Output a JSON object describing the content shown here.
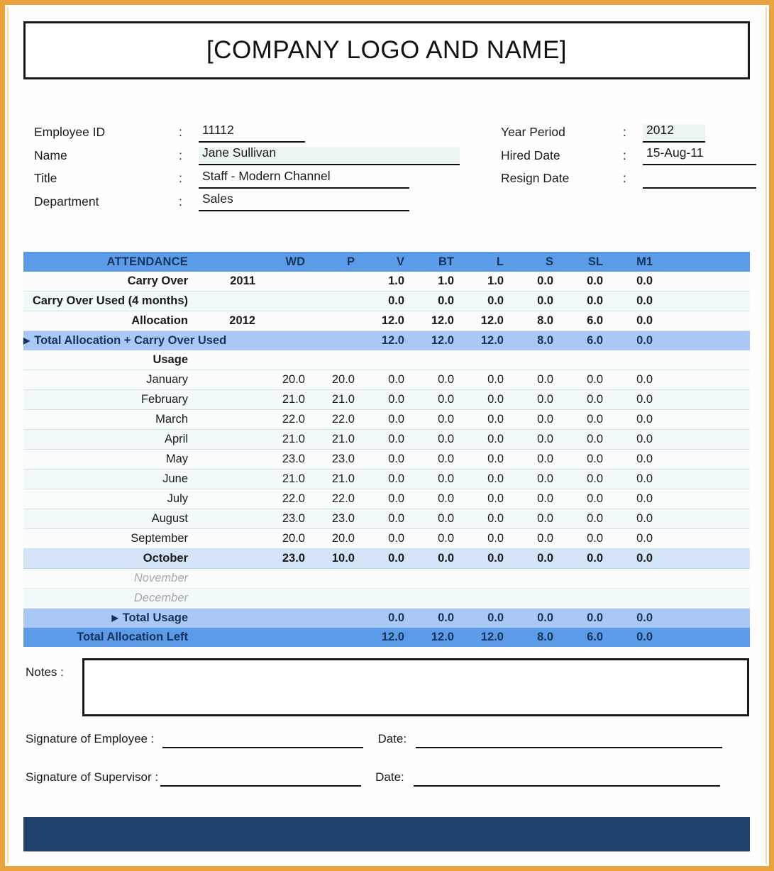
{
  "header": {
    "title": "[COMPANY LOGO AND NAME]"
  },
  "employee_info": {
    "left": [
      {
        "label": "Employee ID",
        "colon": ":",
        "value": "11112"
      },
      {
        "label": "Name",
        "colon": ":",
        "value": "Jane Sullivan"
      },
      {
        "label": "Title",
        "colon": ":",
        "value": "Staff - Modern Channel"
      },
      {
        "label": "Department",
        "colon": ":",
        "value": "Sales"
      }
    ],
    "right": [
      {
        "label": "Year Period",
        "colon": ":",
        "value": "2012"
      },
      {
        "label": "Hired Date",
        "colon": ":",
        "value": "15-Aug-11"
      },
      {
        "label": "Resign Date",
        "colon": ":",
        "value": ""
      }
    ]
  },
  "attendance": {
    "title": "ATTENDANCE",
    "columns": [
      "WD",
      "P",
      "V",
      "BT",
      "L",
      "S",
      "SL",
      "M1"
    ],
    "summary_top": [
      {
        "label": "Carry Over",
        "year": "2011",
        "wd": "",
        "p": "",
        "values": [
          "1.0",
          "1.0",
          "1.0",
          "0.0",
          "0.0",
          "0.0"
        ]
      },
      {
        "label": "Carry Over Used (4 months)",
        "year": "",
        "wd": "",
        "p": "",
        "values": [
          "0.0",
          "0.0",
          "0.0",
          "0.0",
          "0.0",
          "0.0"
        ]
      },
      {
        "label": "Allocation",
        "year": "2012",
        "wd": "",
        "p": "",
        "values": [
          "12.0",
          "12.0",
          "12.0",
          "8.0",
          "6.0",
          "0.0"
        ]
      }
    ],
    "total_allocation_row": {
      "marker": "▶",
      "label": "Total Allocation + Carry Over Used",
      "values": [
        "12.0",
        "12.0",
        "12.0",
        "8.0",
        "6.0",
        "0.0"
      ]
    },
    "usage_label": "Usage",
    "months": [
      {
        "name": "January",
        "values": [
          "20.0",
          "20.0",
          "0.0",
          "0.0",
          "0.0",
          "0.0",
          "0.0",
          "0.0"
        ],
        "state": "normal"
      },
      {
        "name": "February",
        "values": [
          "21.0",
          "21.0",
          "0.0",
          "0.0",
          "0.0",
          "0.0",
          "0.0",
          "0.0"
        ],
        "state": "normal"
      },
      {
        "name": "March",
        "values": [
          "22.0",
          "22.0",
          "0.0",
          "0.0",
          "0.0",
          "0.0",
          "0.0",
          "0.0"
        ],
        "state": "normal"
      },
      {
        "name": "April",
        "values": [
          "21.0",
          "21.0",
          "0.0",
          "0.0",
          "0.0",
          "0.0",
          "0.0",
          "0.0"
        ],
        "state": "normal"
      },
      {
        "name": "May",
        "values": [
          "23.0",
          "23.0",
          "0.0",
          "0.0",
          "0.0",
          "0.0",
          "0.0",
          "0.0"
        ],
        "state": "normal"
      },
      {
        "name": "June",
        "values": [
          "21.0",
          "21.0",
          "0.0",
          "0.0",
          "0.0",
          "0.0",
          "0.0",
          "0.0"
        ],
        "state": "normal"
      },
      {
        "name": "July",
        "values": [
          "22.0",
          "22.0",
          "0.0",
          "0.0",
          "0.0",
          "0.0",
          "0.0",
          "0.0"
        ],
        "state": "normal"
      },
      {
        "name": "August",
        "values": [
          "23.0",
          "23.0",
          "0.0",
          "0.0",
          "0.0",
          "0.0",
          "0.0",
          "0.0"
        ],
        "state": "normal"
      },
      {
        "name": "September",
        "values": [
          "20.0",
          "20.0",
          "0.0",
          "0.0",
          "0.0",
          "0.0",
          "0.0",
          "0.0"
        ],
        "state": "normal"
      },
      {
        "name": "October",
        "values": [
          "23.0",
          "10.0",
          "0.0",
          "0.0",
          "0.0",
          "0.0",
          "0.0",
          "0.0"
        ],
        "state": "current"
      },
      {
        "name": "November",
        "values": [
          "",
          "",
          "",
          "",
          "",
          "",
          "",
          ""
        ],
        "state": "future"
      },
      {
        "name": "December",
        "values": [
          "",
          "",
          "",
          "",
          "",
          "",
          "",
          ""
        ],
        "state": "future"
      }
    ],
    "total_usage_row": {
      "marker": "▶",
      "label": "Total Usage",
      "values": [
        "0.0",
        "0.0",
        "0.0",
        "0.0",
        "0.0",
        "0.0"
      ]
    },
    "total_left_row": {
      "label": "Total Allocation Left",
      "values": [
        "12.0",
        "12.0",
        "12.0",
        "8.0",
        "6.0",
        "0.0"
      ]
    }
  },
  "notes": {
    "label": "Notes :",
    "value": ""
  },
  "signatures": {
    "employee_label": "Signature of Employee :",
    "supervisor_label": "Signature of Supervisor :",
    "date_label": "Date:",
    "employee_value": "",
    "employee_date": "",
    "supervisor_value": "",
    "supervisor_date": ""
  },
  "colors": {
    "frame": "#e8a33d",
    "header_blue": "#5b9be8",
    "summary_light_blue": "#a9c8f5",
    "current_row": "#d3e3f8",
    "footer_navy": "#1f4068",
    "header_text": "#16355c"
  }
}
